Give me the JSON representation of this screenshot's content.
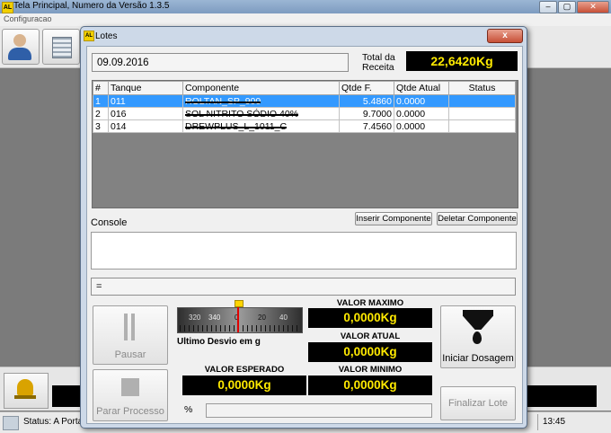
{
  "window": {
    "title": "Tela Principal, Numero da Versão 1.3.5",
    "menu": "Configuracao"
  },
  "status": {
    "text": "Status: A Porta",
    "time": "13:45"
  },
  "dialog": {
    "title": "Lotes",
    "close": "x",
    "date": "09.09.2016",
    "total_label_1": "Total da",
    "total_label_2": "Receita",
    "total_value": "22,6420Kg",
    "table": {
      "headers": [
        "#",
        "Tanque",
        "Componente",
        "Qtde F.",
        "Qtde Atual",
        "Status"
      ],
      "rows": [
        {
          "n": "1",
          "tanque": "011",
          "componente": "ROLTAN_SP_900",
          "qtde_f": "5.4860",
          "qtde_atual": "0.0000",
          "status": ""
        },
        {
          "n": "2",
          "tanque": "016",
          "componente": "SOL NITRITO SÓDIO 40%",
          "qtde_f": "9.7000",
          "qtde_atual": "0.0000",
          "status": ""
        },
        {
          "n": "3",
          "tanque": "014",
          "componente": "DREWPLUS_L_1011_C",
          "qtde_f": "7.4560",
          "qtde_atual": "0.0000",
          "status": ""
        }
      ]
    },
    "console_label": "Console",
    "insert_button": "Inserir Componente",
    "delete_button": "Deletar Componente",
    "formula": "=",
    "gauge": {
      "ticks": [
        "320",
        "340",
        "0",
        "20",
        "40"
      ],
      "label": "Ultimo Desvio em g"
    },
    "pause_button": "Pausar",
    "stop_button": "Parar Processo",
    "start_button": "Iniciar Dosagem",
    "finish_button": "Finalizar Lote",
    "valor_esperado_label": "VALOR ESPERADO",
    "valor_esperado": "0,0000Kg",
    "valor_maximo_label": "VALOR MAXIMO",
    "valor_maximo": "0,0000Kg",
    "valor_atual_label": "VALOR ATUAL",
    "valor_atual": "0,0000Kg",
    "valor_minimo_label": "VALOR MINIMO",
    "valor_minimo": "0,0000Kg",
    "percent_label": "%"
  }
}
